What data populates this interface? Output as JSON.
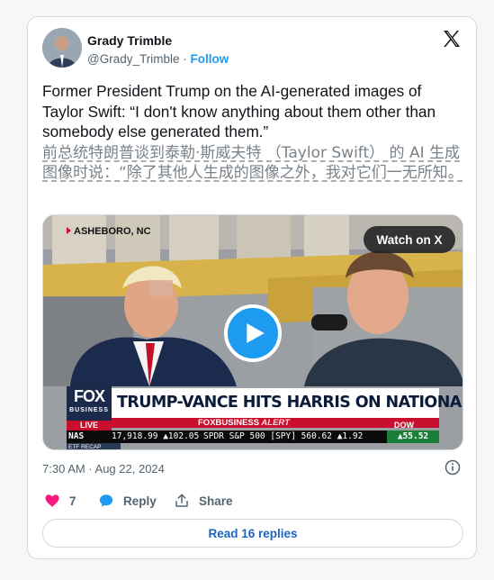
{
  "author": {
    "name": "Grady Trimble",
    "handle": "@Grady_Trimble",
    "separator": "·",
    "follow_label": "Follow"
  },
  "tweet": {
    "text_en": "Former President Trump on the AI-generated images of Taylor Swift: “I don't know anything about them other than somebody else generated them.”",
    "text_zh": "前总统特朗普谈到泰勒·斯威夫特 （Taylor Swift） 的 AI 生成图像时说：“除了其他人生成的图像之外，我对它们一无所知。"
  },
  "media": {
    "location": "ASHEBORO, NC",
    "watch_label": "Watch on X",
    "fox_logo": "FOX",
    "fox_sub": "BUSINESS",
    "live_label": "LIVE",
    "headline": "TRUMP-VANCE HITS HARRIS ON NATIONAL SECURITY IN NC",
    "alert_brand": "FOXBUSINESS",
    "alert_word": "ALERT",
    "etf_label": "ETF RECAP",
    "dow_label": "DOW",
    "ticker_nas": "NAS",
    "ticker_nas_values": "17,918.99 ▲102.05",
    "ticker_spdr": "SPDR S&P 500 [SPY] 560.62 ▲1.92",
    "ticker_dow": "▲55.52"
  },
  "meta": {
    "timestamp": "7:30 AM · Aug 22, 2024"
  },
  "actions": {
    "likes_count": "7",
    "reply_label": "Reply",
    "share_label": "Share"
  },
  "replies_button": "Read 16 replies",
  "colors": {
    "accent": "#1d9bf0",
    "like": "#f91880",
    "fox_red": "#c8102e",
    "fox_navy": "#1b2a4a"
  },
  "icons": [
    "x-logo-icon",
    "play-icon",
    "heart-icon",
    "reply-bubble-icon",
    "share-icon",
    "info-icon"
  ]
}
